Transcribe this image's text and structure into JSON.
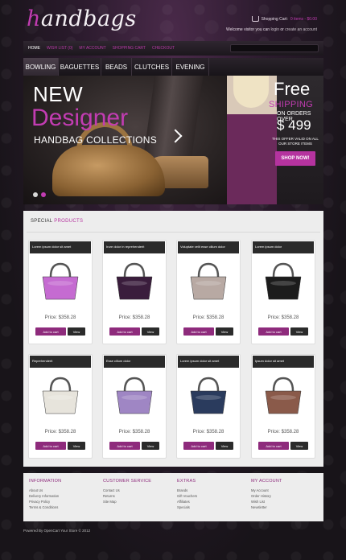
{
  "header": {
    "logo_initial": "h",
    "logo_rest": "andbags",
    "cart_label": "Shopping Cart:",
    "cart_value": "0 items - $0.00",
    "welcome_text": "Welcome visitor you can",
    "login": "login",
    "or": "or",
    "create_account": "create an account"
  },
  "topnav": {
    "items": [
      "HOME",
      "WISH LIST (0)",
      "MY ACCOUNT",
      "SHOPPING CART",
      "CHECKOUT"
    ]
  },
  "catnav": {
    "items": [
      "BOWLING",
      "BAGUETTES",
      "BEADS",
      "CLUTCHES",
      "EVENING"
    ]
  },
  "banner": {
    "new": "NEW",
    "designer": "Designer",
    "collections": "HANDBAG COLLECTIONS",
    "free": "Free",
    "shipping": "SHIPPING",
    "orders_over": "ON ORDERS OVER",
    "amount": "$ 499",
    "valid_text": "THIS OFFER VALID ON ALL OUR STORE ITEMS",
    "shop_now": "SHOP NOW!"
  },
  "products": {
    "title_plain": "SPECIAL",
    "title_accent": "PRODUCTS",
    "price_prefix": "Price:",
    "add_label": "Add to cart",
    "view_label": "View",
    "items": [
      {
        "name": "Lorem ipsum dolor sit amet",
        "price": "$358.28",
        "color": "#c56bd1"
      },
      {
        "name": "Irure dolor in reprehenderit",
        "price": "$358.28",
        "color": "#3a1d3c"
      },
      {
        "name": "Voluptate velit esse cillum dolor",
        "price": "$358.28",
        "color": "#b8a9a3"
      },
      {
        "name": "Lorem ipsum dolor",
        "price": "$358.28",
        "color": "#1c1c1c"
      },
      {
        "name": "Reprehenderit",
        "price": "$358.28",
        "color": "#e7e4dc"
      },
      {
        "name": "Esse cillum dolor",
        "price": "$358.28",
        "color": "#9f86c4"
      },
      {
        "name": "Lorem ipsum dolor sit amet",
        "price": "$358.28",
        "color": "#2a3b5d"
      },
      {
        "name": "Ipsum dolor sit amet",
        "price": "$358.28",
        "color": "#8a5a4a"
      }
    ]
  },
  "footer": {
    "columns": [
      {
        "title": "INFORMATION",
        "links": [
          "About Us",
          "Delivery Information",
          "Privacy Policy",
          "Terms & Conditions"
        ]
      },
      {
        "title": "CUSTOMER SERVICE",
        "links": [
          "Contact Us",
          "Returns",
          "Site Map"
        ]
      },
      {
        "title": "EXTRAS",
        "links": [
          "Brands",
          "Gift Vouchers",
          "Affiliates",
          "Specials"
        ]
      },
      {
        "title": "MY ACCOUNT",
        "links": [
          "My Account",
          "Order History",
          "Wish List",
          "Newsletter"
        ]
      }
    ],
    "copyright": "Powered By OpenCart Your Store © 2012"
  }
}
